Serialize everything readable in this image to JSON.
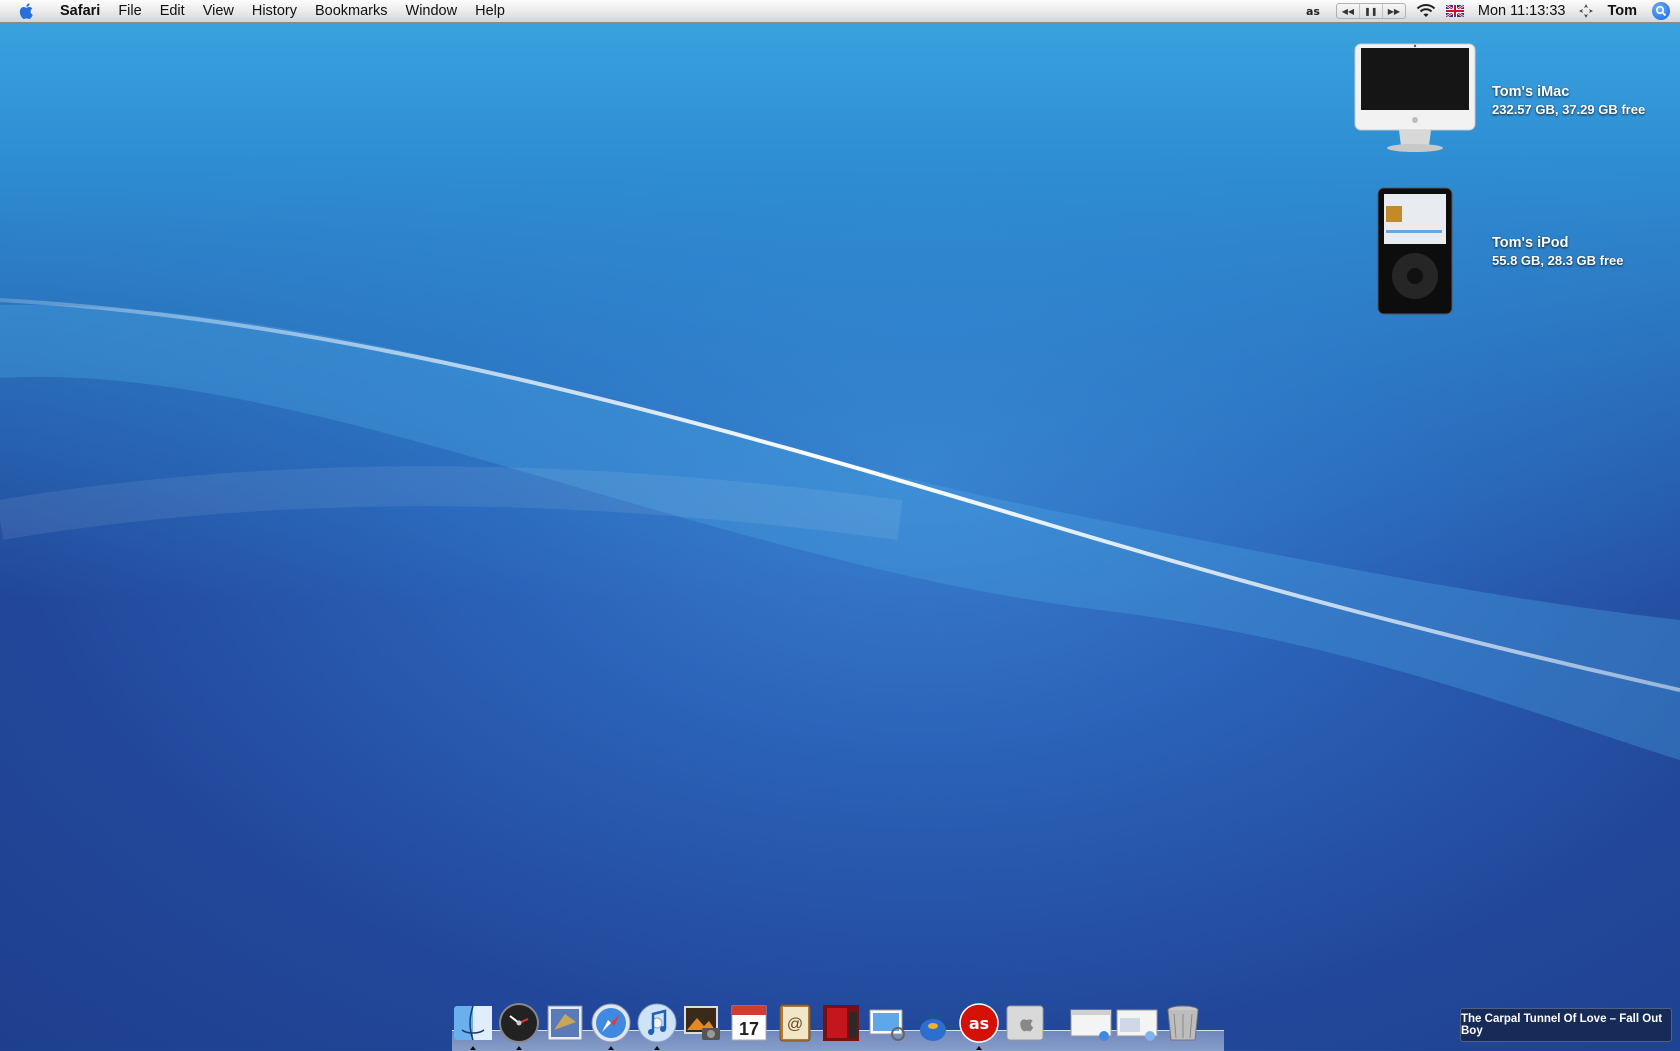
{
  "menubar": {
    "app_name": "Safari",
    "menus": [
      "File",
      "Edit",
      "View",
      "History",
      "Bookmarks",
      "Window",
      "Help"
    ],
    "clock": "Mon 11:13:33",
    "user": "Tom"
  },
  "desktop_icons": [
    {
      "name": "Tom's  iMac",
      "info": "232.57 GB, 37.29 GB free",
      "icon": "imac-icon"
    },
    {
      "name": "Tom's  iPod",
      "info": "55.8 GB, 28.3 GB free",
      "icon": "ipod-icon"
    }
  ],
  "dock": {
    "apps": [
      "finder-icon",
      "dashboard-icon",
      "mail-icon",
      "safari-icon",
      "itunes-icon",
      "iphoto-icon",
      "ical-icon",
      "address-book-icon",
      "front-row-icon",
      "preview-icon",
      "adium-icon",
      "lastfm-icon",
      "system-preferences-icon"
    ],
    "running": [
      "finder-icon",
      "dashboard-icon",
      "safari-icon",
      "itunes-icon",
      "lastfm-icon"
    ],
    "right": [
      "window-thumbnail-icon",
      "window-thumbnail-icon",
      "trash-icon"
    ]
  },
  "now_playing": "The Carpal Tunnel Of Love – Fall Out Boy"
}
